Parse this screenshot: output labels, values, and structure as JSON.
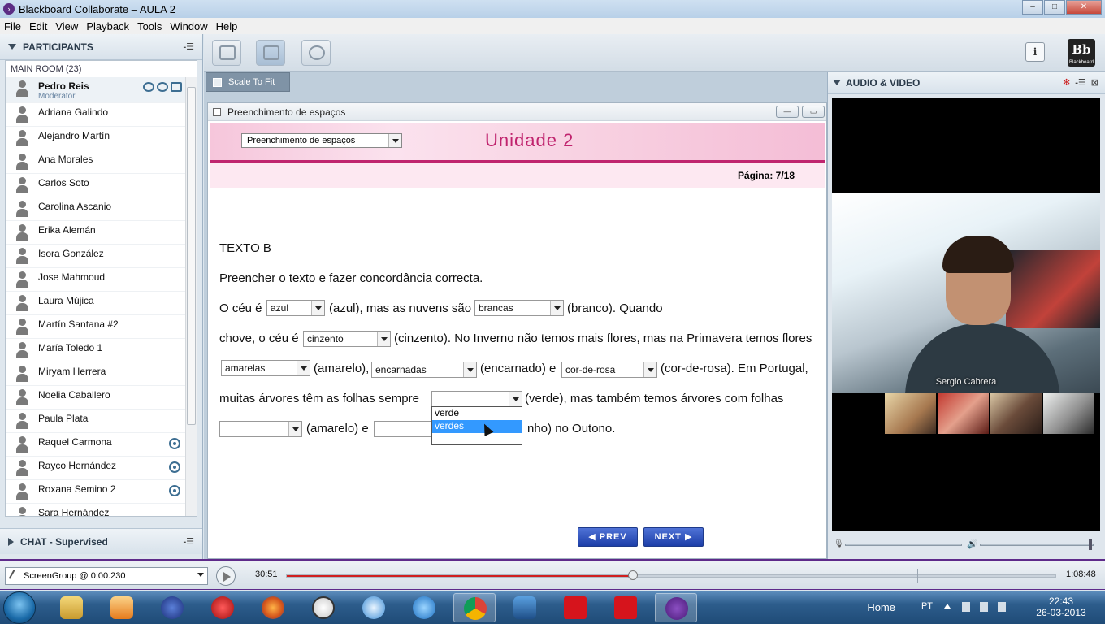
{
  "window": {
    "title": "Blackboard Collaborate – AULA 2",
    "min": "–",
    "max": "□",
    "close": "✕"
  },
  "menu": [
    "File",
    "Edit",
    "View",
    "Playback",
    "Tools",
    "Window",
    "Help"
  ],
  "participants": {
    "header": "PARTICIPANTS",
    "room": "MAIN ROOM",
    "count": "(23)",
    "moderator": {
      "name": "Pedro Reis",
      "role": "Moderator"
    },
    "list": [
      {
        "name": "Adriana Galindo",
        "cam": false
      },
      {
        "name": "Alejandro Martín",
        "cam": false
      },
      {
        "name": "Ana Morales",
        "cam": false
      },
      {
        "name": "Carlos Soto",
        "cam": false
      },
      {
        "name": "Carolina Ascanio",
        "cam": false
      },
      {
        "name": "Erika Alemán",
        "cam": false
      },
      {
        "name": "Isora González",
        "cam": false
      },
      {
        "name": "Jose Mahmoud",
        "cam": false
      },
      {
        "name": "Laura Mújica",
        "cam": false
      },
      {
        "name": "Martín Santana #2",
        "cam": false
      },
      {
        "name": "María Toledo 1",
        "cam": false
      },
      {
        "name": "Miryam Herrera",
        "cam": false
      },
      {
        "name": "Noelia Caballero",
        "cam": false
      },
      {
        "name": "Paula Plata",
        "cam": false
      },
      {
        "name": "Raquel Carmona",
        "cam": true
      },
      {
        "name": "Rayco Hernández",
        "cam": true
      },
      {
        "name": "Roxana Semino 2",
        "cam": true
      },
      {
        "name": "Sara Hernández",
        "cam": false
      }
    ]
  },
  "chat": {
    "header": "CHAT - Supervised"
  },
  "toolbar": {
    "scale_to_fit": "Scale To Fit",
    "info": "i",
    "logo": "Bb",
    "logo_sub": "Blackboard"
  },
  "content": {
    "window_title": "Preenchimento de espaços",
    "min": "—",
    "max": "▭",
    "dropdown": "Preenchimento de espaços",
    "banner_title": "Unidade 2",
    "page": "Página: 7/18",
    "heading": "TEXTO B",
    "instruction": "Preencher o texto e fazer  concordância correcta.",
    "line1": {
      "a": "O céu é",
      "sel1": "azul",
      "b": "(azul), mas as nuvens são",
      "sel2": "brancas",
      "c": "(branco). Quando"
    },
    "line2": {
      "a": "chove, o céu é",
      "sel1": "cinzento",
      "b": "(cinzento). No Inverno não temos mais flores, mas na Primavera temos flores"
    },
    "line3": {
      "sel1": "amarelas",
      "a": "(amarelo),",
      "sel2": "encarnadas",
      "b": "(encarnado) e",
      "sel3": "cor-de-rosa",
      "c": "(cor-de-rosa). Em Portugal,"
    },
    "line4": {
      "a": "muitas árvores têm as folhas sempre",
      "sel1": "",
      "b": "(verde), mas também temos árvores com folhas"
    },
    "line5": {
      "sel1": "",
      "a": "(amarelo) e",
      "sel2": "",
      "b": "nho) no Outono."
    },
    "dropdown_options": [
      "verde",
      "verdes"
    ],
    "highlighted_option": "verdes",
    "prev": "PREV",
    "next": "NEXT"
  },
  "audio_video": {
    "header": "AUDIO & VIDEO",
    "speaker": "Sergio Cabrera"
  },
  "playback": {
    "select": "ScreenGroup @ 0:00.230",
    "elapsed": "30:51",
    "total": "1:08:48",
    "progress": 0.45
  },
  "taskbar": {
    "home": "Home",
    "lang": "PT",
    "time": "22:43",
    "date": "26-03-2013"
  }
}
